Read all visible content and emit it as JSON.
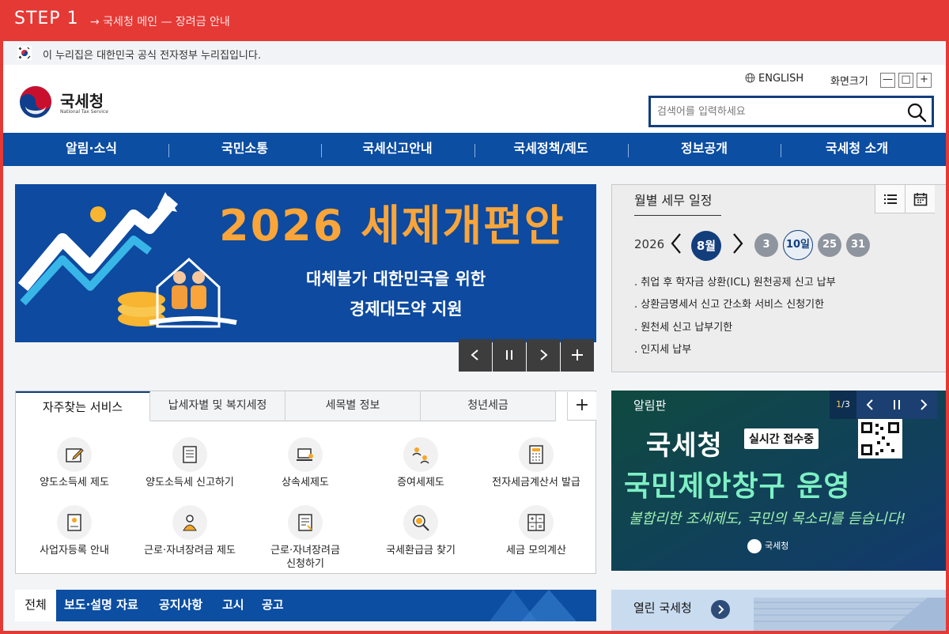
{
  "step": {
    "title": "STEP 1",
    "crumb": "→  국세청 메인 — 장려금 안내"
  },
  "govbar": {
    "text": "이 누리집은 대한민국 공식 전자정부 누리집입니다."
  },
  "logo": {
    "name": "국세청",
    "sub": "National Tax Service"
  },
  "util": {
    "english": "ENGLISH",
    "font_size": "화면크기",
    "minus": "—",
    "reset": "□",
    "plus": "+"
  },
  "search": {
    "placeholder": "검색어를 입력하세요"
  },
  "gnb": [
    "알림·소식",
    "국민소통",
    "국세신고안내",
    "국세정책/제도",
    "정보공개",
    "국세청 소개"
  ],
  "banner": {
    "headline": "2026 세제개편안",
    "sub1": "대체불가 대한민국을 위한",
    "sub2": "경제대도약 지원"
  },
  "calendar": {
    "title": "월별 세무 일정",
    "year": "2026",
    "month": "8월",
    "days": [
      "3",
      "10일",
      "25",
      "31"
    ],
    "events": [
      ". 취업 후 학자금 상환(ICL) 원천공제 신고 납부",
      ". 상환금명세서 신고 간소화 서비스 신청기한",
      ". 원천세 신고 납부기한",
      ". 인지세 납부"
    ]
  },
  "tabs": [
    "자주찾는 서비스",
    "납세자별 및 복지세정",
    "세목별 정보",
    "청년세금"
  ],
  "services": [
    {
      "label": "양도소득세 제도",
      "icon": "document-pen-icon"
    },
    {
      "label": "양도소득세 신고하기",
      "icon": "form-icon"
    },
    {
      "label": "상속세제도",
      "icon": "laptop-icon"
    },
    {
      "label": "증여세제도",
      "icon": "people-exchange-icon"
    },
    {
      "label": "전자세금계산서 발급",
      "icon": "calculator-doc-icon"
    },
    {
      "label": "사업자등록 안내",
      "icon": "id-card-icon"
    },
    {
      "label": "근로·자녀장려금 제도",
      "icon": "family-icon"
    },
    {
      "label": "근로·자녀장려금\n신청하기",
      "icon": "application-icon"
    },
    {
      "label": "국세환급금 찾기",
      "icon": "coin-search-icon"
    },
    {
      "label": "세금 모의계산",
      "icon": "calculator-icon"
    }
  ],
  "notice": {
    "title": "알림판",
    "page_current": "1",
    "page_total": "/3",
    "line1": "국세청",
    "chip": "실시간 접수중",
    "line2": "국민제안창구 운영",
    "line3": "불합리한 조세제도, 국민의 목소리를 듣습니다!",
    "logo": "국세청"
  },
  "board": {
    "tabs": [
      "전체",
      "보도·설명 자료",
      "공지사항",
      "고시",
      "공고"
    ]
  },
  "open_nts": {
    "title": "열린 국세청"
  },
  "colors": {
    "navy": "#123e7c",
    "gnb_blue": "#0b4ea2",
    "step_red": "#e53935",
    "banner_orange": "#f9a53a"
  }
}
